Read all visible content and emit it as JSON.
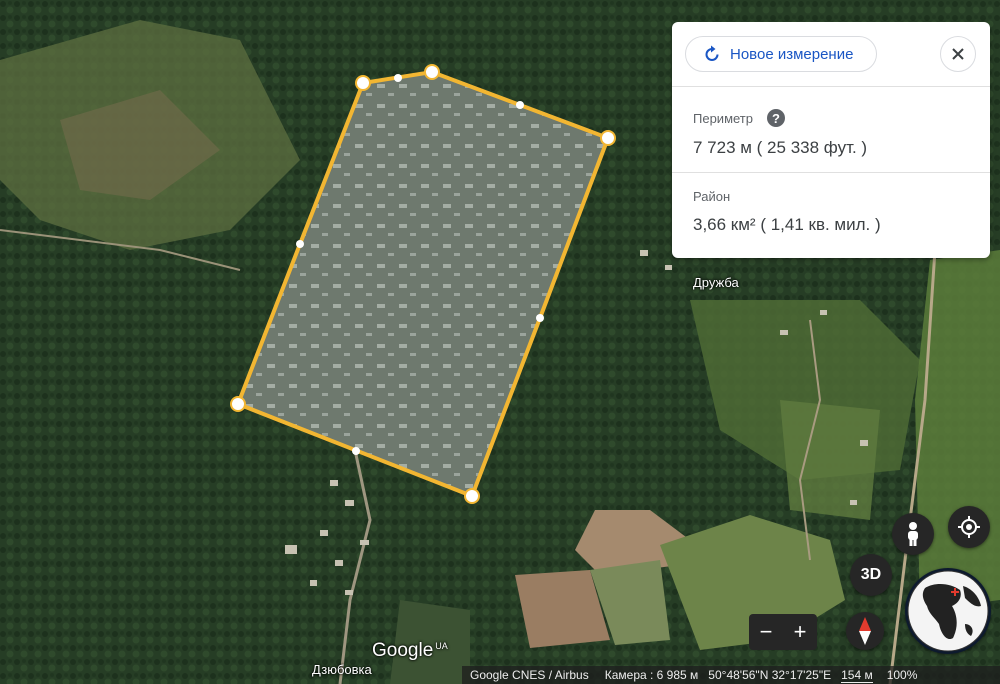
{
  "measure_panel": {
    "new_measurement_label": "Новое измерение",
    "perimeter_label": "Периметр",
    "perimeter_help": "?",
    "perimeter_value": "7 723 м  ( 25 338 фут. )",
    "area_label": "Район",
    "area_value": "3,66 км²  ( 1,41 кв. мил. )"
  },
  "map_labels": {
    "village_north": "Дружба",
    "village_south": "Дзюбовка",
    "google_logo": "Google",
    "google_logo_region": "UA"
  },
  "controls": {
    "three_d_label": "3D",
    "zoom_out": "−",
    "zoom_in": "+"
  },
  "status_bar": {
    "attribution": "Google  CNES / Airbus",
    "camera": "Камера :  6 985 м",
    "coordinates": "50°48'56\"N 32°17'25\"E",
    "scale": "154 м",
    "zoom": "100%"
  },
  "colors": {
    "polygon_stroke": "#f2b632",
    "accent": "#1a56c4"
  },
  "icons": {
    "new_measurement": "refresh-icon",
    "close": "close-icon",
    "pegman": "pegman-icon",
    "location": "my-location-icon",
    "compass": "compass-icon",
    "globe": "globe-icon"
  }
}
